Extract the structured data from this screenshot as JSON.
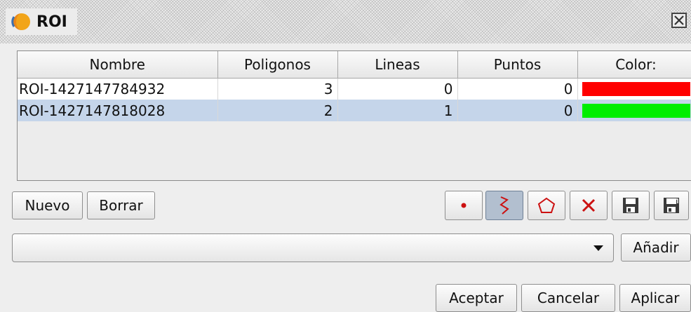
{
  "window": {
    "title": "ROI",
    "icon": "app-logo-icon",
    "close_icon": "close-icon"
  },
  "table": {
    "columns": [
      "Nombre",
      "Poligonos",
      "Lineas",
      "Puntos",
      "Color:"
    ],
    "rows": [
      {
        "name": "ROI-1427147784932",
        "poligonos": "3",
        "lineas": "0",
        "puntos": "0",
        "color": "#ff0000"
      },
      {
        "name": "ROI-1427147818028",
        "poligonos": "2",
        "lineas": "1",
        "puntos": "0",
        "color": "#00ee00"
      }
    ],
    "selected_row": 1
  },
  "buttons": {
    "nuevo": "Nuevo",
    "borrar": "Borrar",
    "anadir": "Añadir",
    "aceptar": "Aceptar",
    "cancelar": "Cancelar",
    "aplicar": "Aplicar"
  },
  "tools": [
    {
      "name": "point-tool-icon",
      "active": false
    },
    {
      "name": "polyline-tool-icon",
      "active": true
    },
    {
      "name": "polygon-tool-icon",
      "active": false
    },
    {
      "name": "delete-tool-icon",
      "active": false
    },
    {
      "name": "save-icon",
      "active": false
    },
    {
      "name": "save-as-icon",
      "active": false
    }
  ],
  "combo": {
    "value": ""
  },
  "colors": {
    "accent": "#cc1111",
    "selection": "#c5d5ea",
    "tool_active": "#b2bfcf"
  }
}
